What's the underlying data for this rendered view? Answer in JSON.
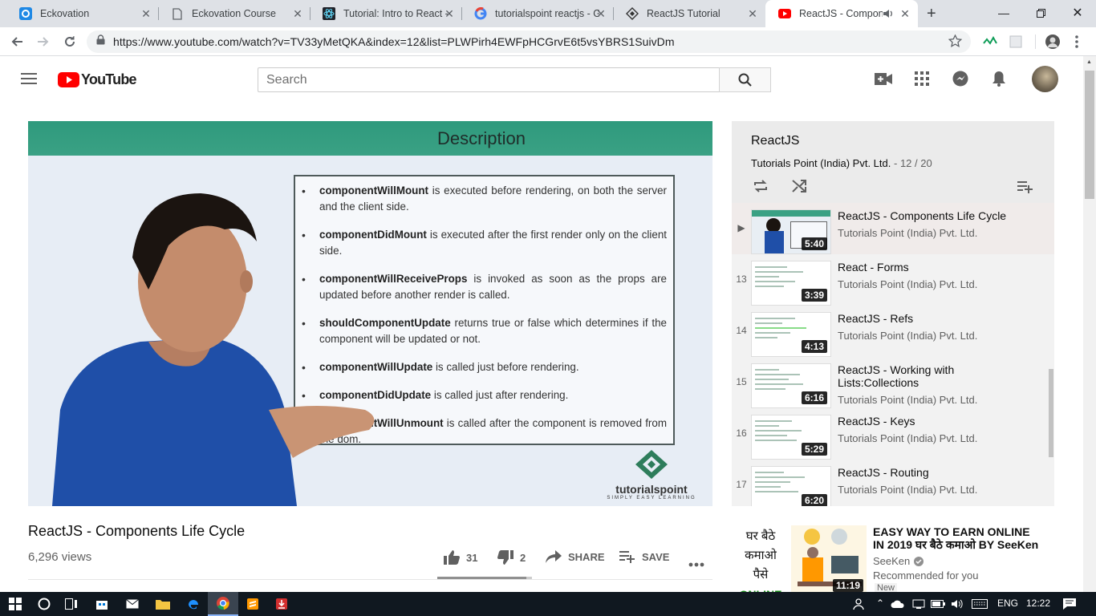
{
  "browser": {
    "tabs": [
      {
        "title": "Eckovation",
        "icon": "eckovation-icon"
      },
      {
        "title": "Eckovation Course",
        "icon": "page-icon"
      },
      {
        "title": "Tutorial: Intro to React -",
        "icon": "react-icon"
      },
      {
        "title": "tutorialspoint reactjs - G",
        "icon": "google-icon"
      },
      {
        "title": "ReactJS Tutorial",
        "icon": "tutorialspoint-icon"
      },
      {
        "title": "ReactJS - Compone",
        "icon": "youtube-icon",
        "active": true,
        "audio": true
      }
    ],
    "url": "https://www.youtube.com/watch?v=TV33yMetQKA&index=12&list=PLWPirh4EWFpHCGrvE6t5vsYBRS1SuivDm"
  },
  "youtube": {
    "logo_text": "YouTube",
    "search_placeholder": "Search",
    "brand_color": "#ff0000"
  },
  "video": {
    "slide_title": "Description",
    "slide_bullets": [
      {
        "term": "componentWillMount",
        "rest": " is executed before rendering, on both the server and the client side."
      },
      {
        "term": "componentDidMount",
        "rest": " is executed after the first render only on the client side."
      },
      {
        "term": "componentWillReceiveProps",
        "rest": " is invoked as soon as the props are updated before another render is called."
      },
      {
        "term": "shouldComponentUpdate",
        "rest": " returns true or false which determines if the component will be updated or not."
      },
      {
        "term": "componentWillUpdate",
        "rest": " is called just before rendering."
      },
      {
        "term": "componentDidUpdate",
        "rest": " is called just after rendering."
      },
      {
        "term": "componentWillUnmount",
        "rest": " is called after the component is removed from the dom."
      }
    ],
    "brand": "tutorialspoint",
    "brand_tagline": "SIMPLY EASY LEARNING",
    "title": "ReactJS - Components Life Cycle",
    "views": "6,296 views",
    "likes": "31",
    "dislikes": "2",
    "share_label": "SHARE",
    "save_label": "SAVE",
    "like_ratio": 0.94
  },
  "playlist": {
    "title": "ReactJS",
    "channel": "Tutorials Point (India) Pvt. Ltd.",
    "position": "12 / 20",
    "items": [
      {
        "index": "▶",
        "title": "ReactJS - Components Life Cycle",
        "channel": "Tutorials Point (India) Pvt. Ltd.",
        "duration": "5:40",
        "current": true
      },
      {
        "index": "13",
        "title": "React - Forms",
        "channel": "Tutorials Point (India) Pvt. Ltd.",
        "duration": "3:39"
      },
      {
        "index": "14",
        "title": "ReactJS - Refs",
        "channel": "Tutorials Point (India) Pvt. Ltd.",
        "duration": "4:13"
      },
      {
        "index": "15",
        "title": "ReactJS - Working with Lists:Collections",
        "channel": "Tutorials Point (India) Pvt. Ltd.",
        "duration": "6:16"
      },
      {
        "index": "16",
        "title": "ReactJS - Keys",
        "channel": "Tutorials Point (India) Pvt. Ltd.",
        "duration": "5:29"
      },
      {
        "index": "17",
        "title": "ReactJS - Routing",
        "channel": "Tutorials Point (India) Pvt. Ltd.",
        "duration": "6:20"
      }
    ]
  },
  "recommendation": {
    "title": "EASY WAY TO EARN ONLINE IN 2019 घर बैठे कमाओ BY SeeKen",
    "channel": "SeeKen",
    "note": "Recommended for you",
    "badge": "New",
    "duration": "11:19",
    "thumb_text_1": "घर बैठे",
    "thumb_text_2": "कमाओ",
    "thumb_text_3": "पैसे",
    "thumb_text_4": "ONLINE"
  },
  "taskbar": {
    "language": "ENG",
    "time": "12:22"
  }
}
